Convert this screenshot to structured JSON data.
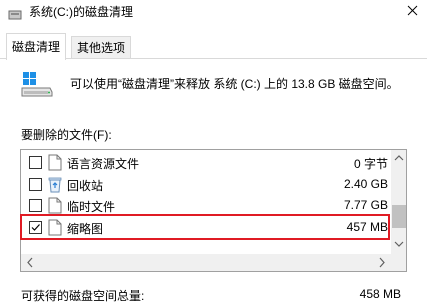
{
  "window": {
    "title": "系统(C:)的磁盘清理"
  },
  "tabs": [
    {
      "label": "磁盘清理",
      "active": true
    },
    {
      "label": "其他选项",
      "active": false
    }
  ],
  "description": "可以使用“磁盘清理”来释放 系统 (C:) 上的 13.8 GB 磁盘空间。",
  "files_section_label": "要删除的文件(F):",
  "file_list": [
    {
      "name": "语言资源文件",
      "size": "0 字节",
      "checked": false,
      "icon": "file-icon"
    },
    {
      "name": "回收站",
      "size": "2.40 GB",
      "checked": false,
      "icon": "recycle-bin-icon"
    },
    {
      "name": "临时文件",
      "size": "7.77 GB",
      "checked": false,
      "icon": "file-icon"
    },
    {
      "name": "缩略图",
      "size": "457 MB",
      "checked": true,
      "icon": "file-icon"
    }
  ],
  "total": {
    "label": "可获得的磁盘空间总量:",
    "value": "458 MB"
  },
  "colors": {
    "highlight": "#e01b24",
    "windows_blue": "#1e90e6"
  }
}
